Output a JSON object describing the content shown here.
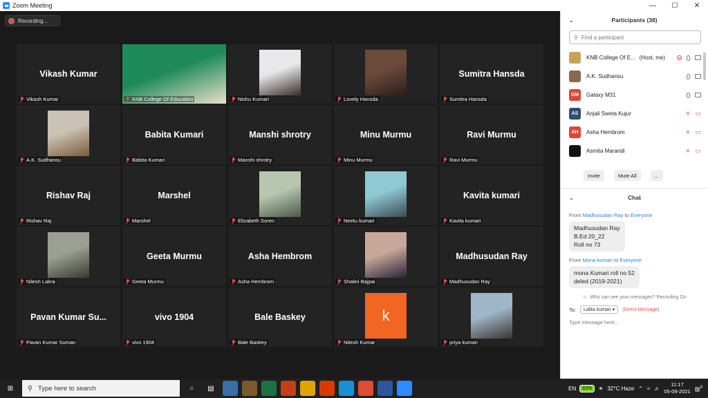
{
  "window": {
    "title": "Zoom Meeting",
    "controls": [
      "—",
      "☐",
      "✕"
    ]
  },
  "recording": {
    "label": "Recording..."
  },
  "tiles": [
    {
      "name": "Vikash Kumar",
      "label": "Vikash Kumar",
      "kind": "text"
    },
    {
      "name": "",
      "label": "KNB College Of Education",
      "kind": "photo",
      "active": true,
      "colors": [
        "#1e8a5a",
        "#e9e0c9"
      ]
    },
    {
      "name": "",
      "label": "Nishu Kumari",
      "kind": "photo",
      "colors": [
        "#e8e8ea",
        "#3a2d28"
      ]
    },
    {
      "name": "",
      "label": "Lovely Hansda",
      "kind": "photo",
      "colors": [
        "#6b4a3c",
        "#2b1d18"
      ]
    },
    {
      "name": "Sumitra Hansda",
      "label": "Sumitra Hansda",
      "kind": "text"
    },
    {
      "name": "",
      "label": "A.K. Sudhansu",
      "kind": "photo",
      "colors": [
        "#c9c2b5",
        "#7a5a3a"
      ]
    },
    {
      "name": "Babita Kumari",
      "label": "Babita Kumari",
      "kind": "text"
    },
    {
      "name": "Manshi shrotry",
      "label": "Manshi shrotry",
      "kind": "text"
    },
    {
      "name": "Minu Murmu",
      "label": "Minu Murmu",
      "kind": "text"
    },
    {
      "name": "Ravi Murmu",
      "label": "Ravi Murmu",
      "kind": "text"
    },
    {
      "name": "Rishav Raj",
      "label": "Rishav Raj",
      "kind": "text"
    },
    {
      "name": "Marshel",
      "label": "Marshel",
      "kind": "text"
    },
    {
      "name": "",
      "label": "Elizabeth Soren",
      "kind": "photo",
      "colors": [
        "#b8c6b0",
        "#4a5a48"
      ]
    },
    {
      "name": "",
      "label": "Neetu kumari",
      "kind": "photo",
      "colors": [
        "#8fc9d4",
        "#3c4b52"
      ]
    },
    {
      "name": "Kavita kumari",
      "label": "Kavita kumari",
      "kind": "text"
    },
    {
      "name": "",
      "label": "Nilesh Lakra",
      "kind": "photo",
      "colors": [
        "#9aa094",
        "#3a3a30"
      ]
    },
    {
      "name": "Geeta Murmu",
      "label": "Geeta Murmu",
      "kind": "text"
    },
    {
      "name": "Asha Hembrom",
      "label": "Asha Hembrom",
      "kind": "text"
    },
    {
      "name": "",
      "label": "Shalini Bajpai",
      "kind": "photo",
      "colors": [
        "#c9a89a",
        "#2a2438"
      ]
    },
    {
      "name": "Madhusudan Ray",
      "label": "Madhusudan Ray",
      "kind": "text"
    },
    {
      "name": "Pavan Kumar Su...",
      "label": "Pavan Kumar Suman",
      "kind": "text"
    },
    {
      "name": "vivo 1904",
      "label": "vivo 1904",
      "kind": "text"
    },
    {
      "name": "Bale Baskey",
      "label": "Bale Baskey",
      "kind": "text"
    },
    {
      "name": "k",
      "label": "Nitesh Kumar",
      "kind": "letter",
      "colors": [
        "#f26522",
        "#f26522"
      ]
    },
    {
      "name": "",
      "label": "priya kumari",
      "kind": "photo",
      "colors": [
        "#9fb6c8",
        "#3b3430"
      ]
    }
  ],
  "participants": {
    "title": "Participants (38)",
    "search_placeholder": "Find a participant",
    "list": [
      {
        "initials": "",
        "name": "KNB College Of E...",
        "suffix": "(Host, me)",
        "color": "#c7a35a",
        "state": "host"
      },
      {
        "initials": "",
        "name": "A.K. Sudhansu",
        "suffix": "",
        "color": "#8a6a4a",
        "state": "mic"
      },
      {
        "initials": "GM",
        "name": "Galaxy M31",
        "suffix": "",
        "color": "#d9473b",
        "state": "mic"
      },
      {
        "initials": "AS",
        "name": "Anjali Sweta Kujur",
        "suffix": "",
        "color": "#2f4f6f",
        "state": "muted"
      },
      {
        "initials": "AH",
        "name": "Asha Hembrom",
        "suffix": "",
        "color": "#d9473b",
        "state": "muted"
      },
      {
        "initials": "",
        "name": "Asmita Marandi",
        "suffix": "",
        "color": "#111111",
        "state": "muted"
      }
    ],
    "invite": "Invite",
    "mute_all": "Mute All",
    "more": "..."
  },
  "chat": {
    "title": "Chat",
    "messages": [
      {
        "from": "Madhusudan Ray",
        "to": "Everyone",
        "lines": [
          "Madhusudan Ray",
          "B.Ed 20_22",
          "Roll no 73"
        ]
      },
      {
        "from": "Mona kumari",
        "to": "Everyone",
        "lines": [
          "mona Kumari roll no 52",
          "deled (2019-2021)"
        ]
      }
    ],
    "privacy": "Who can see your messages? Recording On",
    "to_label": "To:",
    "to_value": "Lalita kumari",
    "dm": "(Direct Message)",
    "placeholder": "Type message here..."
  },
  "taskbar": {
    "search": "Type here to search",
    "lang": "EN",
    "battery": "83%",
    "weather": "32°C  Haze",
    "time": "11:17",
    "date": "05-09-2021",
    "notif": "3"
  }
}
